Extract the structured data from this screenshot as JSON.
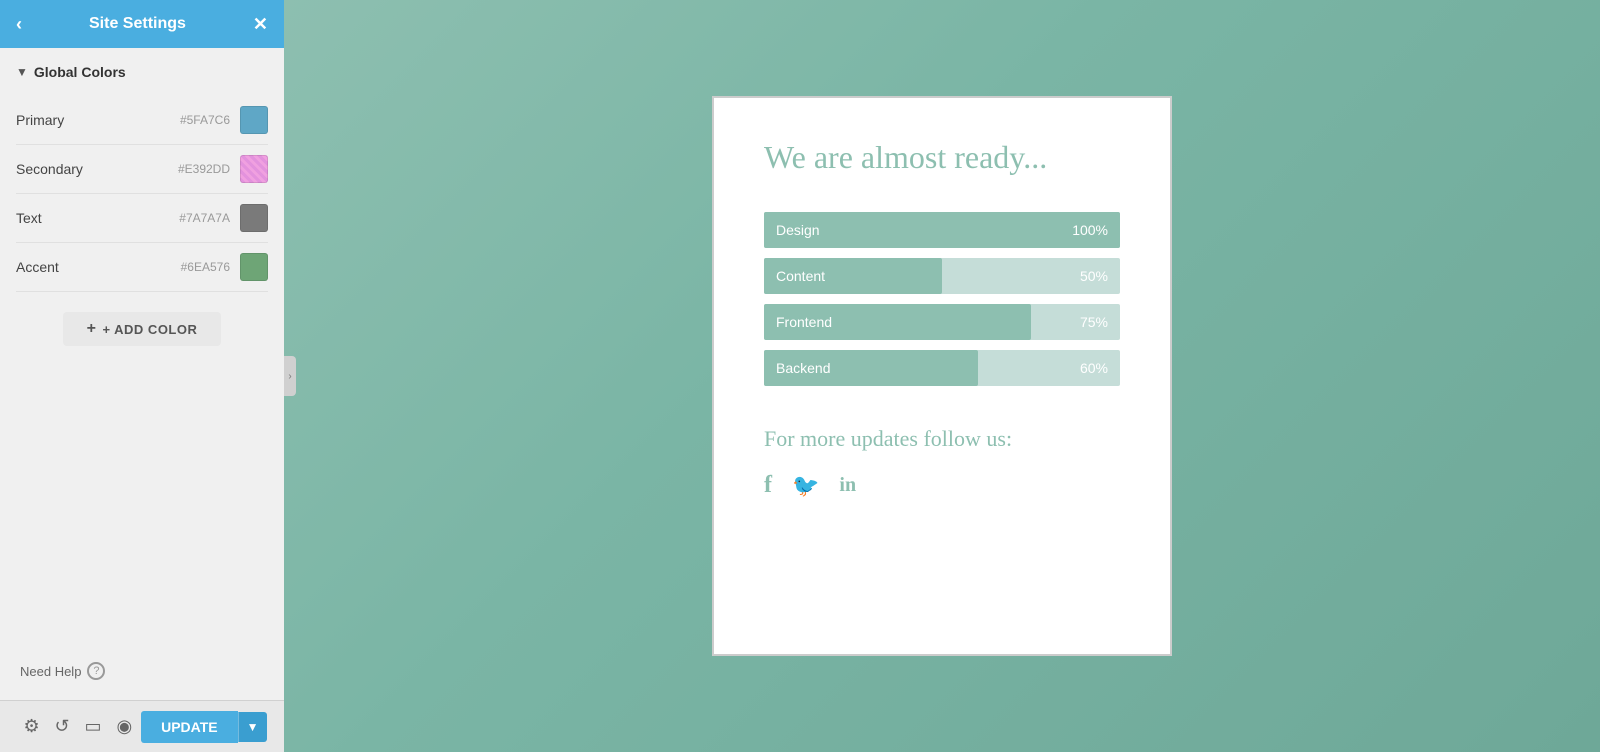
{
  "sidebar": {
    "header": {
      "title": "Site Settings",
      "back_icon": "‹",
      "close_icon": "✕"
    },
    "global_colors": {
      "section_title": "Global Colors",
      "colors": [
        {
          "label": "Primary",
          "hex": "#5FA7C6",
          "swatch": "#5FA7C6"
        },
        {
          "label": "Secondary",
          "hex": "#E392DD",
          "swatch": "#E392DD"
        },
        {
          "label": "Text",
          "hex": "#7A7A7A",
          "swatch": "#7A7A7A"
        },
        {
          "label": "Accent",
          "hex": "#6EA576",
          "swatch": "#6EA576"
        }
      ]
    },
    "add_color_btn": "+ ADD COLOR",
    "need_help": "Need Help",
    "footer": {
      "update_btn": "UPDATE",
      "dropdown_arrow": "▼"
    }
  },
  "preview": {
    "title": "We are almost ready...",
    "progress_items": [
      {
        "label": "Design",
        "percent": 100,
        "display": "100%"
      },
      {
        "label": "Content",
        "percent": 50,
        "display": "50%"
      },
      {
        "label": "Frontend",
        "percent": 75,
        "display": "75%"
      },
      {
        "label": "Backend",
        "percent": 60,
        "display": "60%"
      }
    ],
    "follow_title": "For more updates follow us:",
    "social_icons": [
      "f",
      "🐦",
      "in"
    ]
  },
  "colors": {
    "accent": "#4aaee0",
    "teal": "#8dbfb0",
    "progress_bg": "#c5ddd8"
  }
}
